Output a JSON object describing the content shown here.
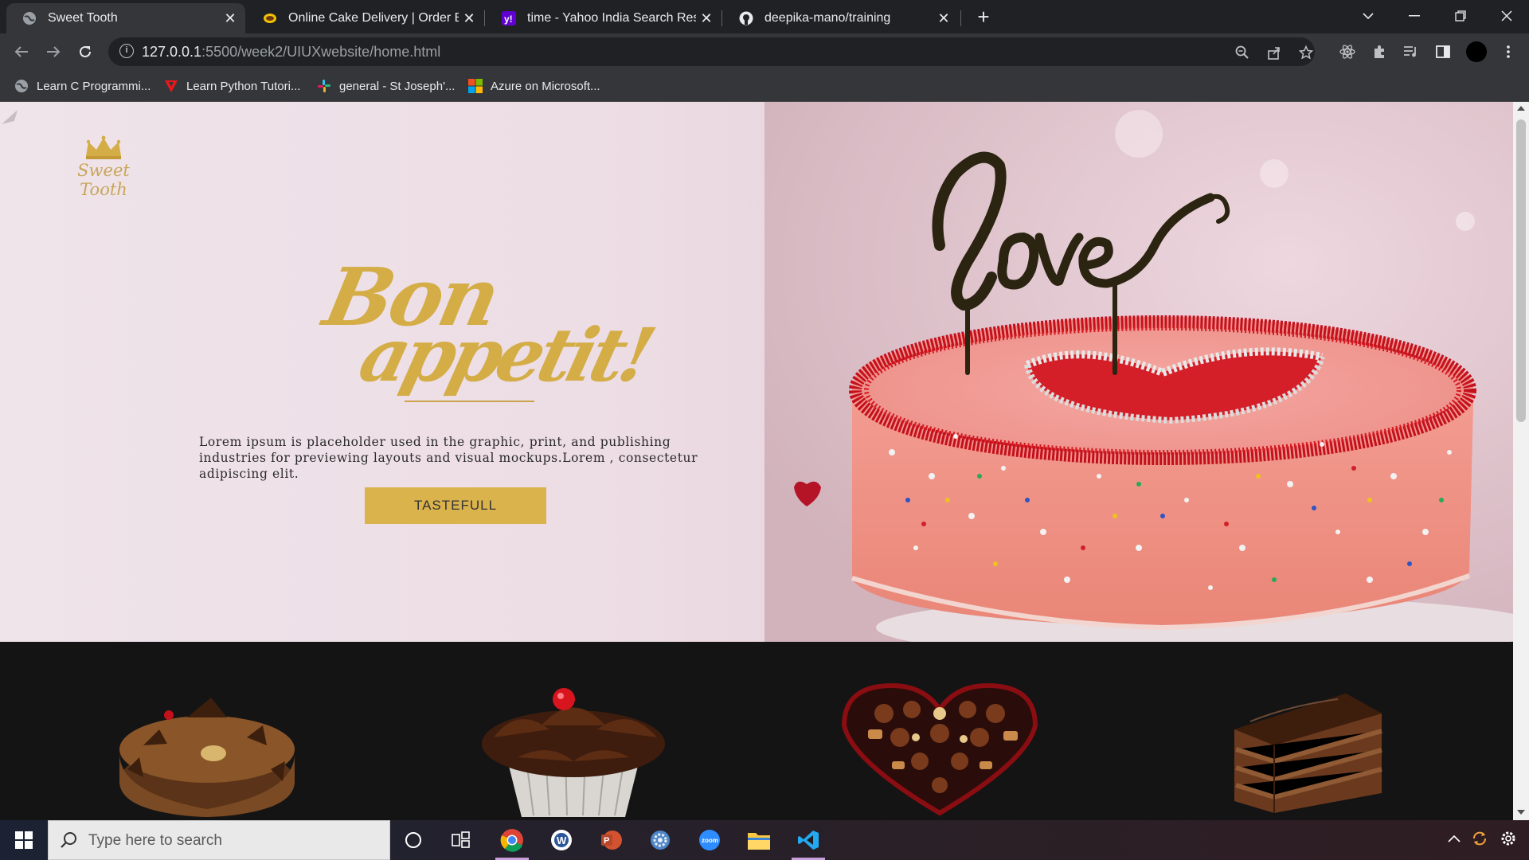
{
  "browser": {
    "tabs": [
      {
        "title": "Sweet Tooth",
        "active": true,
        "icon": "globe-icon"
      },
      {
        "title": "Online Cake Delivery | Order Best",
        "active": false,
        "icon": "cake-site-icon"
      },
      {
        "title": "time - Yahoo India Search Results",
        "active": false,
        "icon": "yahoo-icon"
      },
      {
        "title": "deepika-mano/training",
        "active": false,
        "icon": "github-icon"
      }
    ],
    "close_glyph": "✕",
    "new_tab_glyph": "+",
    "url_host": "127.0.0.1",
    "url_path": ":5500/week2/UIUXwebsite/home.html",
    "bookmarks": [
      {
        "label": "Learn C Programmi...",
        "icon": "globe-icon"
      },
      {
        "label": "Learn Python Tutori...",
        "icon": "python-tutorial-icon"
      },
      {
        "label": "general - St Joseph'...",
        "icon": "slack-icon"
      },
      {
        "label": "Azure on Microsoft...",
        "icon": "microsoft-icon"
      }
    ]
  },
  "page": {
    "logo_text": "Sweet Tooth",
    "hero_title_line1": "Bon",
    "hero_title_line2": "appetit!",
    "hero_body": "Lorem ipsum is placeholder used in the graphic, print, and publishing industries for previewing layouts and visual mockups.Lorem , consectetur adipiscing elit.",
    "cta_label": "TASTEFULL",
    "cake_topper": "love",
    "products": [
      "chocolate-cake-image",
      "cupcake-image",
      "chocolate-box-heart-image",
      "pastry-slice-image"
    ]
  },
  "taskbar": {
    "search_placeholder": "Type here to search",
    "apps": [
      "cortana-icon",
      "task-view-icon",
      "chrome-icon",
      "word-icon",
      "powerpoint-icon",
      "settings-icon",
      "zoom-icon",
      "file-explorer-icon",
      "vscode-icon"
    ]
  },
  "colors": {
    "accent_gold": "#d4ad47",
    "button_gold": "#dbb34d",
    "hero_bg": "#efe4ea",
    "products_bg": "#141414"
  }
}
